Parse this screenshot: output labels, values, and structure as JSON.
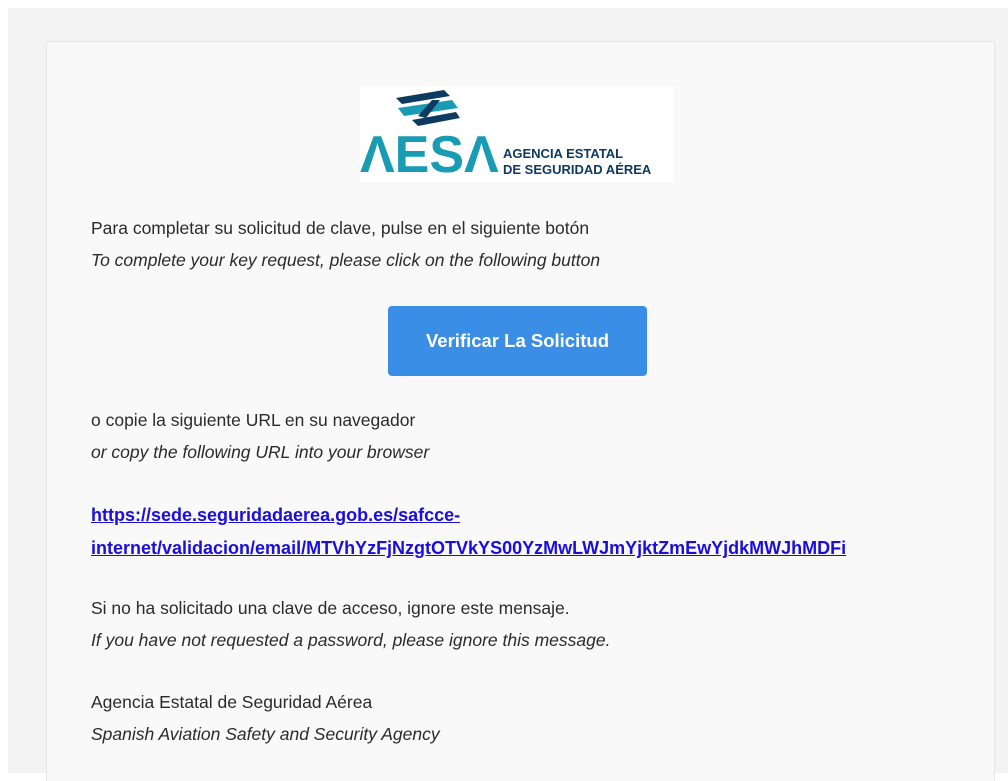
{
  "logo": {
    "letters": "ΛESΛ",
    "line1": "AGENCIA ESTATAL",
    "line2": "DE SEGURIDAD AÉREA",
    "brand_color": "#1a9bb4",
    "navy_color": "#0f3a60"
  },
  "intro": {
    "es": "Para completar su solicitud de clave, pulse en el siguiente botón",
    "en": "To complete your key request, please click on the following button"
  },
  "verify_button": {
    "label": "Verificar La Solicitud",
    "color": "#3a8ee6"
  },
  "copy_url": {
    "es": "o copie la siguiente URL en su navegador",
    "en": "or copy the following URL into your browser"
  },
  "url": {
    "line1": "https://sede.seguridadaerea.gob.es/safcce-",
    "line2": "internet/validacion/email/MTVhYzFjNzgtOTVkYS00YzMwLWJmYjktZmEwYjdkMWJhMDFi"
  },
  "ignore": {
    "es": "Si no ha solicitado una clave de acceso, ignore este mensaje.",
    "en": "If you have not requested a password, please ignore this message."
  },
  "signature": {
    "es": "Agencia Estatal de Seguridad Aérea",
    "en": "Spanish Aviation Safety and Security Agency"
  }
}
